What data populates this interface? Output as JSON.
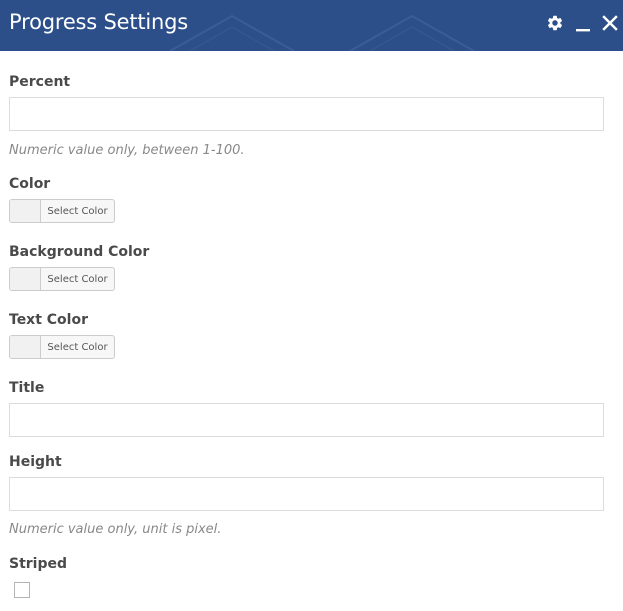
{
  "header": {
    "title": "Progress Settings",
    "background": "#2c4f8a",
    "icons": [
      "gear-icon",
      "minimize-icon",
      "close-icon"
    ]
  },
  "fields": {
    "percent": {
      "label": "Percent",
      "value": "",
      "hint": "Numeric value only, between 1-100."
    },
    "color": {
      "label": "Color",
      "button_label": "Select Color"
    },
    "background_color": {
      "label": "Background Color",
      "button_label": "Select Color"
    },
    "text_color": {
      "label": "Text Color",
      "button_label": "Select Color"
    },
    "title": {
      "label": "Title",
      "value": ""
    },
    "height": {
      "label": "Height",
      "value": "",
      "hint": "Numeric value only, unit is pixel."
    },
    "striped": {
      "label": "Striped",
      "checked": false
    }
  }
}
